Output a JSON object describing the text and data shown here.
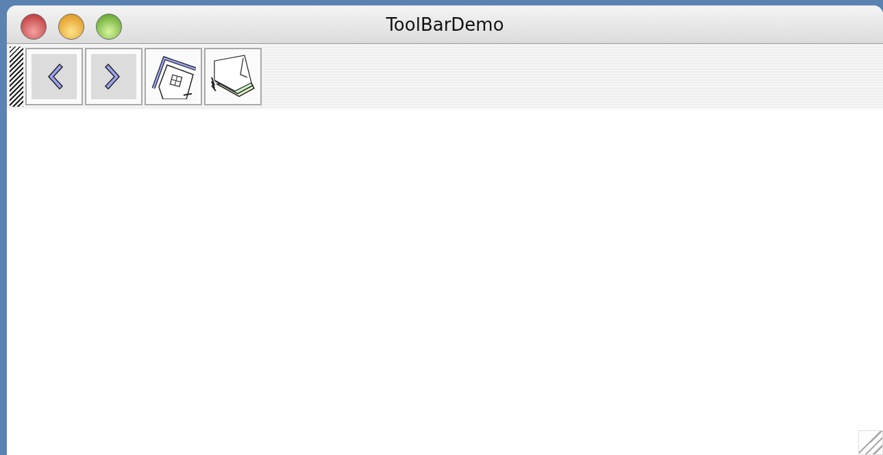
{
  "window": {
    "title": "ToolBarDemo"
  },
  "toolbar": {
    "buttons": [
      {
        "kind": "back"
      },
      {
        "kind": "forward"
      },
      {
        "kind": "home"
      },
      {
        "kind": "pages"
      }
    ]
  }
}
